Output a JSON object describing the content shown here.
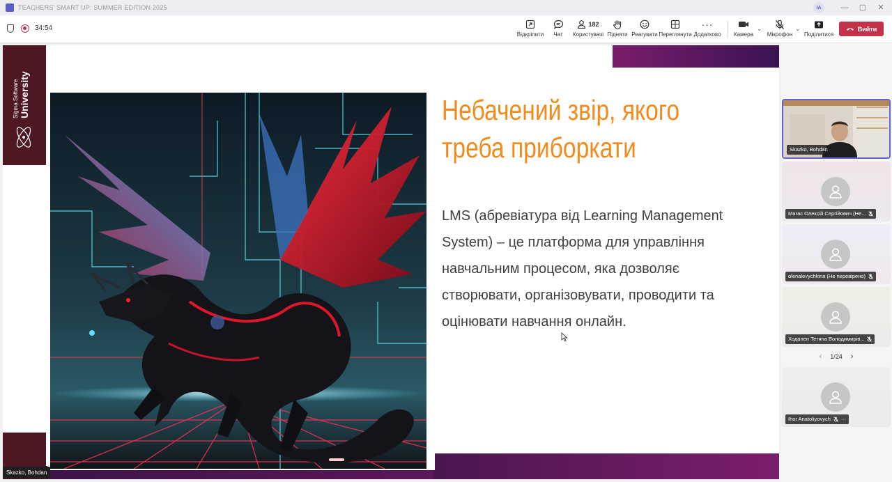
{
  "window": {
    "title": "TEACHERS' SMART UP: SUMMER EDITION 2025",
    "user_initials": "IA",
    "controls": {
      "minimize": "—",
      "maximize": "▢",
      "close": "✕"
    }
  },
  "toolbar": {
    "timer": "34:54",
    "items": [
      {
        "label": "Відкріпити",
        "icon": "unpin-icon"
      },
      {
        "label": "Чат",
        "icon": "chat-icon"
      },
      {
        "label": "Користувачі",
        "icon": "people-icon",
        "count": "182"
      },
      {
        "label": "Підняти",
        "icon": "raise-hand-icon"
      },
      {
        "label": "Реагувати",
        "icon": "react-icon"
      },
      {
        "label": "Переглянути",
        "icon": "view-icon"
      },
      {
        "label": "Додатково",
        "icon": "more-icon"
      },
      {
        "label": "Камера",
        "icon": "camera-icon"
      },
      {
        "label": "Мікрофон",
        "icon": "mic-off-icon"
      },
      {
        "label": "Поділитися",
        "icon": "share-icon"
      }
    ],
    "leave_label": "Вийти",
    "leave_color": "#c4314b"
  },
  "slide": {
    "brand_top": "Sigma Software",
    "brand_main": "University",
    "heading_line1": "Небачений звір, якого",
    "heading_line2": "треба приборкати",
    "heading_color": "#f28a1c",
    "body": [
      "LMS (абревіатура від Learning Management",
      "System) – це платформа для управління",
      "навчальним процесом, яка дозволяє",
      "створювати, організовувати, проводити та",
      "оцінювати навчання онлайн."
    ]
  },
  "presenter": "Skazko, Bohdan",
  "participants": [
    {
      "name": "Skazko, Bohdan",
      "video": true,
      "muted": false
    },
    {
      "name": "Магас Олексій Сергійович (Не...",
      "video": false,
      "muted": true
    },
    {
      "name": "olenalevychkina (Не перевірено)",
      "video": false,
      "muted": true
    },
    {
      "name": "Ходанен Тетяна Володимирів...",
      "video": false,
      "muted": true
    },
    {
      "name": "Ihor Anatoliyovych",
      "video": false,
      "muted": true,
      "more": "···"
    }
  ],
  "pager": {
    "label": "1/24",
    "prev": "‹",
    "next": "›"
  }
}
